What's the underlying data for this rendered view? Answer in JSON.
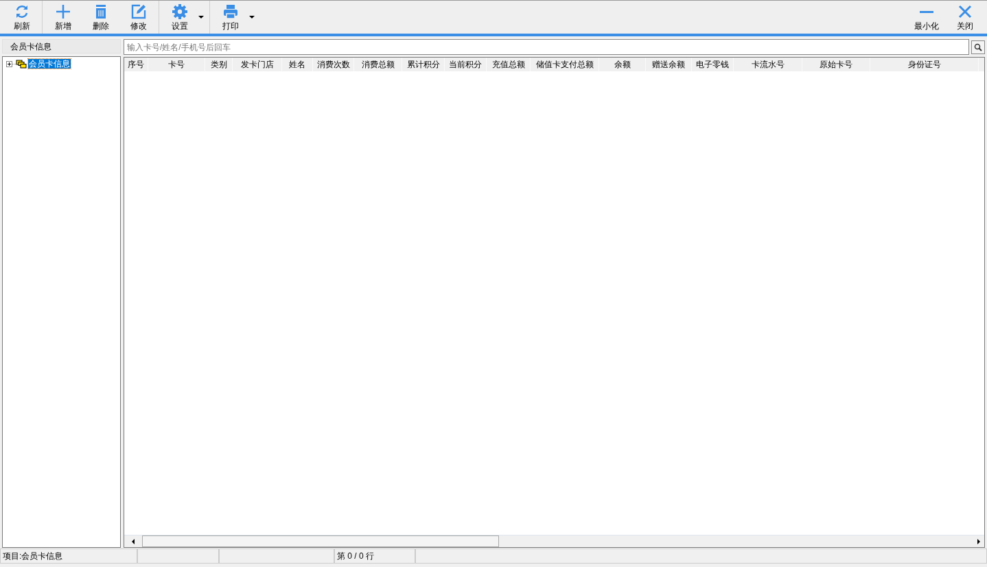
{
  "toolbar": {
    "items": [
      {
        "kind": "refresh",
        "label": "刷新",
        "dropdown": false
      },
      {
        "kind": "add",
        "label": "新增",
        "dropdown": false
      },
      {
        "kind": "delete",
        "label": "删除",
        "dropdown": false
      },
      {
        "kind": "edit",
        "label": "修改",
        "dropdown": false
      },
      {
        "kind": "settings",
        "label": "设置",
        "dropdown": true
      },
      {
        "kind": "print",
        "label": "打印",
        "dropdown": true
      }
    ],
    "window_buttons": [
      {
        "kind": "minimize",
        "label": "最小化"
      },
      {
        "kind": "close",
        "label": "关闭"
      }
    ]
  },
  "sidebar": {
    "title": "会员卡信息",
    "tree": [
      {
        "label": "会员卡信息",
        "selected": true,
        "expanded": false
      }
    ]
  },
  "search": {
    "placeholder": "输入卡号/姓名/手机号后回车"
  },
  "table": {
    "columns": [
      "序号",
      "卡号",
      "类别",
      "发卡门店",
      "姓名",
      "消费次数",
      "消费总额",
      "累计积分",
      "当前积分",
      "充值总额",
      "储值卡支付总额",
      "余额",
      "赠送余额",
      "电子零钱",
      "卡流水号",
      "原始卡号",
      "身份证号"
    ]
  },
  "status_bar": {
    "project": "项目:会员卡信息",
    "row_count": "第 0 / 0 行"
  }
}
